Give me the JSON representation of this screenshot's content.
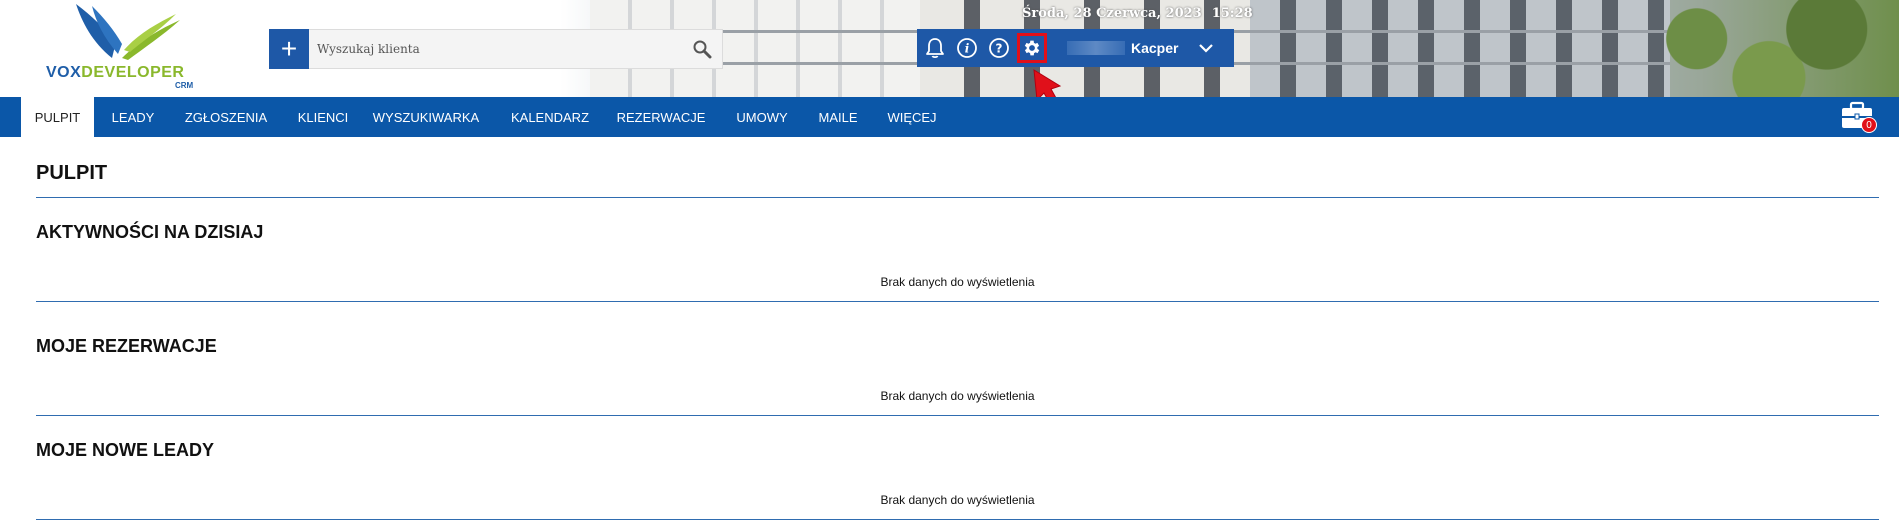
{
  "logo": {
    "text_main": "VOX",
    "text_accent": "DEVELOPER",
    "subtitle": "CRM"
  },
  "search": {
    "add_symbol": "+",
    "placeholder": "Wyszukaj klienta"
  },
  "header": {
    "date": "Środa, 28 Czerwca, 2023",
    "time": "15:28"
  },
  "user": {
    "name": "Kacper"
  },
  "icons": {
    "add": "plus-icon",
    "search": "search-icon",
    "notifications": "bell-icon",
    "info": "info-icon",
    "help": "help-icon",
    "settings": "gear-icon",
    "user_menu": "chevron-down-icon",
    "cart": "briefcase-icon",
    "pointer": "arrow-pointer-icon"
  },
  "nav": {
    "items": [
      {
        "label": "PULPIT",
        "active": true
      },
      {
        "label": "LEADY",
        "active": false
      },
      {
        "label": "ZGŁOSZENIA",
        "active": false
      },
      {
        "label": "KLIENCI",
        "active": false
      },
      {
        "label": "WYSZUKIWARKA",
        "active": false
      },
      {
        "label": "KALENDARZ",
        "active": false
      },
      {
        "label": "REZERWACJE",
        "active": false
      },
      {
        "label": "UMOWY",
        "active": false
      },
      {
        "label": "MAILE",
        "active": false
      },
      {
        "label": "WIĘCEJ",
        "active": false
      }
    ],
    "cart_count": "0"
  },
  "main": {
    "title": "PULPIT",
    "sections": [
      {
        "title": "AKTYWNOŚCI NA DZISIAJ",
        "empty_text": "Brak danych do wyświetlenia"
      },
      {
        "title": "MOJE REZERWACJE",
        "empty_text": "Brak danych do wyświetlenia"
      },
      {
        "title": "MOJE NOWE LEADY",
        "empty_text": "Brak danych do wyświetlenia"
      }
    ]
  },
  "colors": {
    "primary": "#1e58a7",
    "nav": "#0b57a8",
    "highlight": "#e0101a",
    "logo_green": "#8ab82c"
  }
}
